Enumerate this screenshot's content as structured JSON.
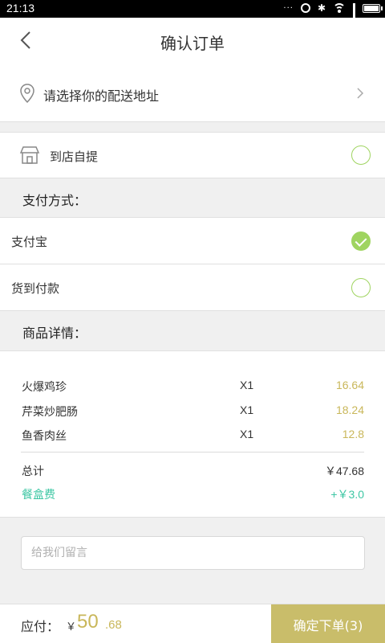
{
  "status_bar": {
    "time": "21:13",
    "dots": "···"
  },
  "header": {
    "title": "确认订单"
  },
  "address": {
    "label": "请选择你的配送地址"
  },
  "pickup": {
    "label": "到店自提",
    "selected": false
  },
  "payment": {
    "title": "支付方式：",
    "options": [
      {
        "label": "支付宝",
        "selected": true
      },
      {
        "label": "货到付款",
        "selected": false
      }
    ]
  },
  "goods": {
    "title": "商品详情：",
    "items": [
      {
        "name": "火爆鸡珍",
        "qty": "X1",
        "price": "16.64"
      },
      {
        "name": "芹菜炒肥肠",
        "qty": "X1",
        "price": "18.24"
      },
      {
        "name": "鱼香肉丝",
        "qty": "X1",
        "price": "12.8"
      }
    ],
    "total_label": "总计",
    "total_value": "￥47.68",
    "fee_label": "餐盒费",
    "fee_value": "+￥3.0"
  },
  "message": {
    "placeholder": "给我们留言",
    "value": ""
  },
  "footer": {
    "due_label": "应付：",
    "currency": "￥",
    "due_int": "50",
    "due_dec": ".68",
    "submit_label": "确定下单(3)"
  },
  "colors": {
    "accent": "#c9b75a",
    "check": "#9fd460",
    "fee": "#3ec7a4",
    "button": "#c9bd6a"
  }
}
